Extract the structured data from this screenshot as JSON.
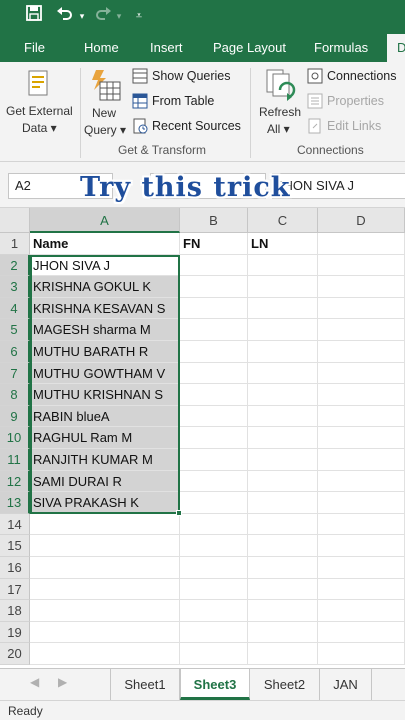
{
  "ribbon_tabs": [
    "File",
    "Home",
    "Insert",
    "Page Layout",
    "Formulas",
    "D"
  ],
  "get_external": {
    "line1": "Get External",
    "line2": "Data ▾"
  },
  "new_query": {
    "line1": "New",
    "line2": "Query ▾"
  },
  "show_queries": "Show Queries",
  "from_table": "From Table",
  "recent_sources": "Recent Sources",
  "refresh": {
    "line1": "Refresh",
    "line2": "All ▾"
  },
  "connections": "Connections",
  "properties": "Properties",
  "edit_links": "Edit Links",
  "groups": {
    "get_transform": "Get & Transform",
    "connections": "Connections"
  },
  "name_box": "A2",
  "formula_value": "JHON SIVA J",
  "overlay_text": "Try this trick",
  "columns": [
    "A",
    "B",
    "C",
    "D"
  ],
  "rows": [
    "1",
    "2",
    "3",
    "4",
    "5",
    "6",
    "7",
    "8",
    "9",
    "10",
    "11",
    "12",
    "13",
    "14",
    "15",
    "16",
    "17",
    "18",
    "19",
    "20"
  ],
  "header_row": {
    "a": "Name",
    "b": "FN",
    "c": "LN"
  },
  "names": [
    "JHON SIVA J",
    "KRISHNA GOKUL K",
    "KRISHNA KESAVAN S",
    "MAGESH sharma M",
    "MUTHU BARATH R",
    "MUTHU GOWTHAM V",
    "MUTHU KRISHNAN S",
    "RABIN blueA",
    "RAGHUL Ram M",
    "RANJITH KUMAR M",
    "SAMI DURAI R",
    "SIVA PRAKASH K"
  ],
  "sheet_tabs": [
    "Sheet1",
    "Sheet3",
    "Sheet2",
    "JAN"
  ],
  "status": "Ready",
  "colors": {
    "excel_green": "#217346",
    "selection_fill": "#d3d3d3",
    "overlay_blue": "#1f4e9c"
  }
}
